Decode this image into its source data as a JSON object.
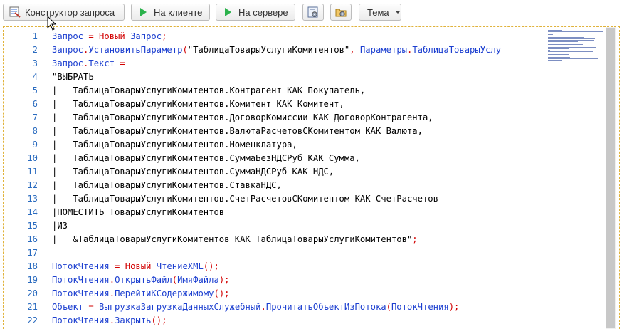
{
  "toolbar": {
    "query_builder_label": "Конструктор запроса",
    "on_client_label": "На клиенте",
    "on_server_label": "На сервере",
    "theme_label": "Тема"
  },
  "editor": {
    "lines": [
      {
        "n": "1",
        "tokens": [
          {
            "t": "Запрос",
            "c": "kw"
          },
          {
            "t": " = ",
            "c": "op"
          },
          {
            "t": "Новый",
            "c": "op"
          },
          {
            "t": " Запрос",
            "c": "kw"
          },
          {
            "t": ";",
            "c": "op"
          }
        ]
      },
      {
        "n": "2",
        "tokens": [
          {
            "t": "Запрос",
            "c": "kw"
          },
          {
            "t": ".",
            "c": "op"
          },
          {
            "t": "УстановитьПараметр",
            "c": "kw"
          },
          {
            "t": "(",
            "c": "op"
          },
          {
            "t": "\"ТаблицаТоварыУслугиКомитентов\"",
            "c": "tx"
          },
          {
            "t": ", ",
            "c": "op"
          },
          {
            "t": "Параметры",
            "c": "kw"
          },
          {
            "t": ".",
            "c": "op"
          },
          {
            "t": "ТаблицаТоварыУслу",
            "c": "kw"
          }
        ]
      },
      {
        "n": "3",
        "tokens": [
          {
            "t": "Запрос",
            "c": "kw"
          },
          {
            "t": ".",
            "c": "op"
          },
          {
            "t": "Текст",
            "c": "kw"
          },
          {
            "t": " =",
            "c": "op"
          }
        ]
      },
      {
        "n": "4",
        "tokens": [
          {
            "t": "\"ВЫБРАТЬ",
            "c": "tx"
          }
        ]
      },
      {
        "n": "5",
        "tokens": [
          {
            "t": "|   ТаблицаТоварыУслугиКомитентов.Контрагент КАК Покупатель,",
            "c": "tx"
          }
        ]
      },
      {
        "n": "6",
        "tokens": [
          {
            "t": "|   ТаблицаТоварыУслугиКомитентов.Комитент КАК Комитент,",
            "c": "tx"
          }
        ]
      },
      {
        "n": "7",
        "tokens": [
          {
            "t": "|   ТаблицаТоварыУслугиКомитентов.ДоговорКомиссии КАК ДоговорКонтрагента,",
            "c": "tx"
          }
        ]
      },
      {
        "n": "8",
        "tokens": [
          {
            "t": "|   ТаблицаТоварыУслугиКомитентов.ВалютаРасчетовСКомитентом КАК Валюта,",
            "c": "tx"
          }
        ]
      },
      {
        "n": "9",
        "tokens": [
          {
            "t": "|   ТаблицаТоварыУслугиКомитентов.Номенклатура,",
            "c": "tx"
          }
        ]
      },
      {
        "n": "10",
        "tokens": [
          {
            "t": "|   ТаблицаТоварыУслугиКомитентов.СуммаБезНДСРуб КАК Сумма,",
            "c": "tx"
          }
        ]
      },
      {
        "n": "11",
        "tokens": [
          {
            "t": "|   ТаблицаТоварыУслугиКомитентов.СуммаНДСРуб КАК НДС,",
            "c": "tx"
          }
        ]
      },
      {
        "n": "12",
        "tokens": [
          {
            "t": "|   ТаблицаТоварыУслугиКомитентов.СтавкаНДС,",
            "c": "tx"
          }
        ]
      },
      {
        "n": "13",
        "tokens": [
          {
            "t": "|   ТаблицаТоварыУслугиКомитентов.СчетРасчетовСКомитентом КАК СчетРасчетов",
            "c": "tx"
          }
        ]
      },
      {
        "n": "14",
        "tokens": [
          {
            "t": "|ПОМЕСТИТЬ ТоварыУслугиКомитентов",
            "c": "tx"
          }
        ]
      },
      {
        "n": "15",
        "tokens": [
          {
            "t": "|ИЗ",
            "c": "tx"
          }
        ]
      },
      {
        "n": "16",
        "tokens": [
          {
            "t": "|   &ТаблицаТоварыУслугиКомитентов КАК ТаблицаТоварыУслугиКомитентов\"",
            "c": "tx"
          },
          {
            "t": ";",
            "c": "op"
          }
        ]
      },
      {
        "n": "17",
        "tokens": []
      },
      {
        "n": "18",
        "tokens": [
          {
            "t": "ПотокЧтения",
            "c": "kw"
          },
          {
            "t": " = ",
            "c": "op"
          },
          {
            "t": "Новый",
            "c": "op"
          },
          {
            "t": " ЧтениеXML",
            "c": "kw"
          },
          {
            "t": "();",
            "c": "op"
          }
        ]
      },
      {
        "n": "19",
        "tokens": [
          {
            "t": "ПотокЧтения",
            "c": "kw"
          },
          {
            "t": ".",
            "c": "op"
          },
          {
            "t": "ОткрытьФайл",
            "c": "kw"
          },
          {
            "t": "(",
            "c": "op"
          },
          {
            "t": "ИмяФайла",
            "c": "kw"
          },
          {
            "t": ");",
            "c": "op"
          }
        ]
      },
      {
        "n": "20",
        "tokens": [
          {
            "t": "ПотокЧтения",
            "c": "kw"
          },
          {
            "t": ".",
            "c": "op"
          },
          {
            "t": "ПерейтиКСодержимому",
            "c": "kw"
          },
          {
            "t": "();",
            "c": "op"
          }
        ]
      },
      {
        "n": "21",
        "tokens": [
          {
            "t": "Объект",
            "c": "kw"
          },
          {
            "t": " = ",
            "c": "op"
          },
          {
            "t": "ВыгрузкаЗагрузкаДанныхСлужебный",
            "c": "kw"
          },
          {
            "t": ".",
            "c": "op"
          },
          {
            "t": "ПрочитатьОбъектИзПотока",
            "c": "kw"
          },
          {
            "t": "(",
            "c": "op"
          },
          {
            "t": "ПотокЧтения",
            "c": "kw"
          },
          {
            "t": ");",
            "c": "op"
          }
        ]
      },
      {
        "n": "22",
        "tokens": [
          {
            "t": "ПотокЧтения",
            "c": "kw"
          },
          {
            "t": ".",
            "c": "op"
          },
          {
            "t": "Закрыть",
            "c": "kw"
          },
          {
            "t": "();",
            "c": "op"
          }
        ]
      }
    ]
  },
  "colors": {
    "keyword": "#1c3fd0",
    "operator": "#d20000",
    "line_number": "#2a6bbf",
    "run_icon": "#2bb24c",
    "focus_border": "#e0b23a"
  },
  "icons": {
    "query_builder": "query-builder-icon",
    "run": "play-icon",
    "settings_1": "module-settings-icon",
    "settings_2": "folder-settings-icon",
    "theme": "chevron-down-icon"
  }
}
